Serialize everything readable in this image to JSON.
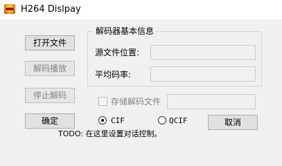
{
  "window": {
    "title": "H264 Dislpay",
    "icon": "app-icon"
  },
  "buttons": {
    "open_file": "打开文件",
    "decode_play": "解码播放",
    "stop_decode": "停止解码",
    "confirm": "确定",
    "cancel": "取消"
  },
  "decoder_info": {
    "group_title": "解码器基本信息",
    "source_position_label": "源文件位置:",
    "source_position_value": "",
    "avg_bitrate_label": "平均码率:",
    "avg_bitrate_value": ""
  },
  "store": {
    "checkbox_label": "存储解码文件",
    "checked": false,
    "path_value": ""
  },
  "format": {
    "options": [
      "CIF",
      "QCIF"
    ],
    "selected": "CIF"
  },
  "todo_text": "TODO: 在这里设置对话控制。",
  "colors": {
    "background": "#f0f0f0",
    "button_face": "#e1e1e1",
    "disabled_text": "#838383"
  }
}
